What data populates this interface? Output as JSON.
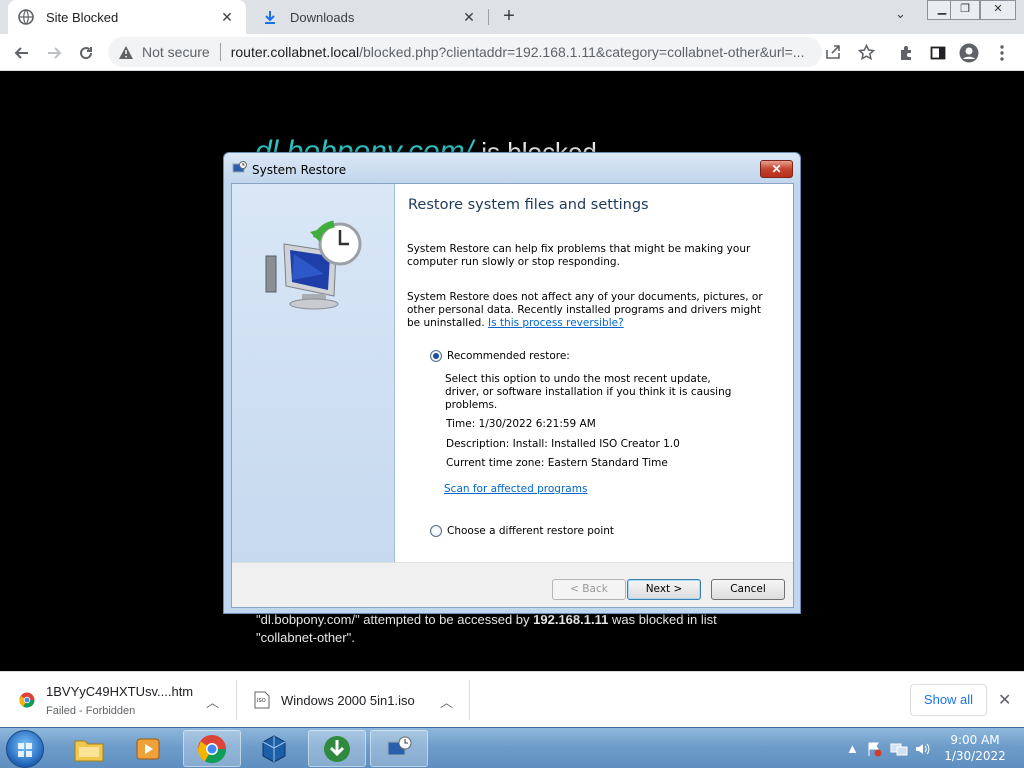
{
  "browser": {
    "tabs": [
      {
        "label": "Site Blocked",
        "active": true,
        "icon": "globe-icon"
      },
      {
        "label": "Downloads",
        "active": false,
        "icon": "download-icon"
      }
    ],
    "window_controls": [
      "minimize",
      "restore",
      "close"
    ],
    "address": {
      "security_label": "Not secure",
      "host": "router.collabnet.local",
      "path": "/blocked.php?clientaddr=192.168.1.11&category=collabnet-other&url=..."
    }
  },
  "page": {
    "blocked_domain": "dl.bobpony.com/",
    "blocked_suffix": "is blocked",
    "message_domain": "dl.bobpony.com/",
    "message_part1": "attempted to be accessed by",
    "message_ip": "192.168.1.11",
    "message_part2": "was blocked in list",
    "message_list": "\"collabnet-other\"."
  },
  "dialog": {
    "title": "System Restore",
    "heading": "Restore system files and settings",
    "para1": "System Restore can help fix problems that might be making your computer run slowly or stop responding.",
    "para2": "System Restore does not affect any of your documents, pictures, or other personal data. Recently installed programs and drivers might be uninstalled.",
    "reversible_link": "Is this process reversible?",
    "recommended_label": "Recommended restore:",
    "recommended_desc": "Select this option to undo the most recent update, driver, or software installation if you think it is causing problems.",
    "time_line": "Time: 1/30/2022 6:21:59 AM",
    "description_line": "Description: Install: Installed ISO Creator 1.0",
    "timezone_line": "Current time zone: Eastern Standard Time",
    "scan_link": "Scan for affected programs",
    "different_label": "Choose a different restore point",
    "selected_option": "recommended",
    "buttons": {
      "back": "< Back",
      "next": "Next >",
      "cancel": "Cancel"
    }
  },
  "downloads": {
    "items": [
      {
        "name": "1BVYyC49HXTUsv....htm",
        "status": "Failed - Forbidden",
        "icon": "chrome-icon"
      },
      {
        "name": "Windows 2000 5in1.iso",
        "status": "",
        "icon": "iso-file-icon"
      }
    ],
    "show_all": "Show all"
  },
  "taskbar": {
    "apps": [
      "explorer",
      "media-player",
      "chrome",
      "virtualbox",
      "internet-download-manager",
      "system-restore"
    ],
    "clock_time": "9:00 AM",
    "clock_date": "1/30/2022"
  }
}
